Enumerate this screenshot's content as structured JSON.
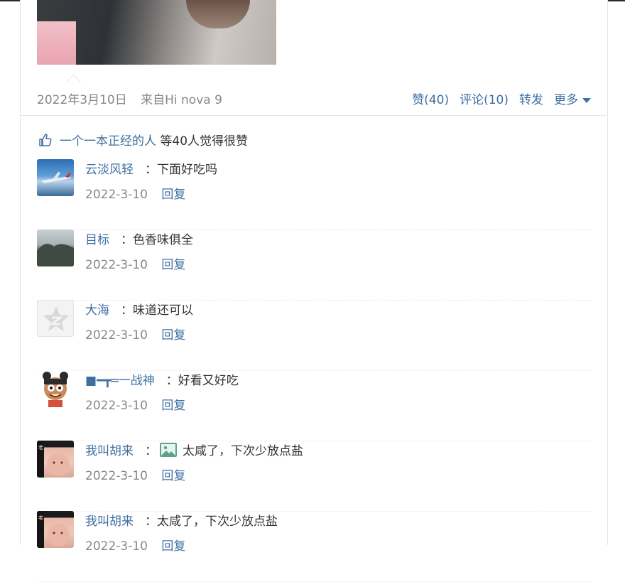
{
  "post": {
    "date": "2022年3月10日",
    "source": "来自Hi nova 9",
    "actions": {
      "like": "赞(40)",
      "comment": "评论(10)",
      "forward": "转发",
      "more": "更多"
    }
  },
  "likes": {
    "user": "一个一本正经的人",
    "count_text": "等40人",
    "suffix": "觉得很赞"
  },
  "comments": [
    {
      "name": "云淡风轻",
      "text": "：下面好吃吗",
      "date": "2022-3-10",
      "reply": "回复",
      "avatar": "plane"
    },
    {
      "name": "目标",
      "text": "：色香味俱全",
      "date": "2022-3-10",
      "reply": "回复",
      "avatar": "mountain"
    },
    {
      "name": "大海",
      "text": "：味道还可以",
      "date": "2022-3-10",
      "reply": "回复",
      "avatar": "default"
    },
    {
      "name": "■━┳═一战神",
      "text": "：好看又好吃",
      "date": "2022-3-10",
      "reply": "回复",
      "avatar": "cartoon"
    },
    {
      "name": "我叫胡来",
      "text_prefix": "：",
      "text": "太咸了，下次少放点盐",
      "date": "2022-3-10",
      "reply": "回复",
      "avatar": "baby",
      "has_image_icon": true
    },
    {
      "name": "我叫胡来",
      "text": "：太咸了，下次少放点盐",
      "date": "2022-3-10",
      "reply": "回复",
      "avatar": "baby"
    }
  ],
  "colors": {
    "link": "#3e6fa0",
    "muted": "#888888",
    "text": "#333333"
  }
}
